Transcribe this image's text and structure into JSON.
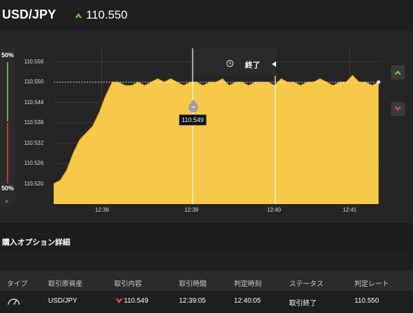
{
  "header": {
    "pair": "USD/JPY",
    "rate": "110.550",
    "trend_icon": "up-arrow-icon",
    "trend_color": "#7fc241"
  },
  "sidebar": {
    "top_pct": "50%",
    "bottom_pct": "50%",
    "close_glyph": "×"
  },
  "chart": {
    "end_label": "終了",
    "tooltip": "110.549",
    "buy_up_icon": "chevron-up-icon",
    "buy_down_icon": "chevron-down-icon"
  },
  "chart_data": {
    "type": "area",
    "title": "",
    "xlabel": "",
    "ylabel": "",
    "x_ticks": [
      "12:38",
      "12:39",
      "12:40",
      "12:41"
    ],
    "y_ticks": [
      "110.556",
      "110.550",
      "110.544",
      "110.538",
      "110.532",
      "110.526",
      "110.520"
    ],
    "ylim": [
      110.514,
      110.56
    ],
    "grid": true,
    "fill_color": "#f7c948",
    "series": [
      {
        "values": [
          110.52,
          110.521,
          110.524,
          110.529,
          110.533,
          110.535,
          110.537,
          110.541,
          110.546,
          110.55,
          110.55,
          110.549,
          110.549,
          110.55,
          110.549,
          110.55,
          110.551,
          110.55,
          110.551,
          110.55,
          110.549,
          110.55,
          110.55,
          110.549,
          110.55,
          110.55,
          110.551,
          110.549,
          110.55,
          110.55,
          110.549,
          110.55,
          110.55,
          110.55,
          110.549,
          110.551,
          110.55,
          110.55,
          110.549,
          110.55,
          110.55,
          110.551,
          110.55,
          110.549,
          110.55,
          110.55,
          110.552,
          110.55,
          110.55,
          110.549,
          110.55
        ]
      }
    ],
    "reference_line": 110.55
  },
  "section": {
    "title": "購入オプション詳細"
  },
  "table": {
    "headers": [
      "タイプ",
      "取引原資産",
      "取引内容",
      "取引時間",
      "判定時刻",
      "ステータス",
      "判定レート"
    ],
    "row": {
      "type_icon": "gauge-icon",
      "asset": "USD/JPY",
      "trade": "110.549",
      "trade_icon": "down-arrow-icon",
      "trade_time": "12:39:05",
      "judge_time": "12:40:05",
      "status": "取引終了",
      "judge_rate": "110.550"
    }
  }
}
